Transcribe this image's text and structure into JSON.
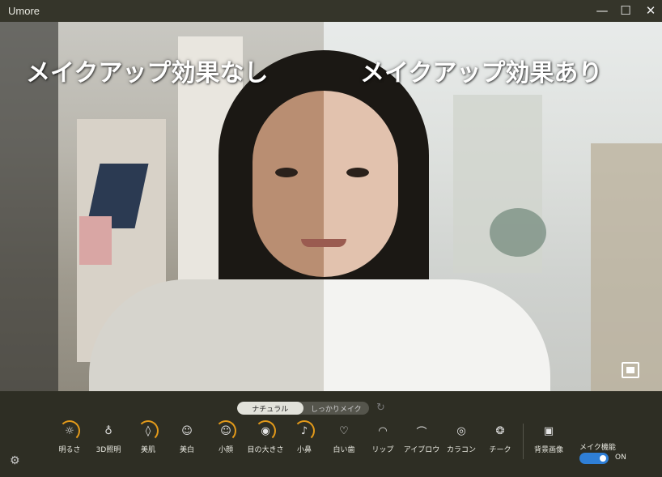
{
  "window": {
    "title": "Umore",
    "minimize_glyph": "—",
    "maximize_glyph": "☐",
    "close_glyph": "✕"
  },
  "preview": {
    "label_without": "メイクアップ効果なし",
    "label_with": "メイクアップ効果あり",
    "pip_icon": "picture-in-picture-icon"
  },
  "modes": {
    "options": [
      "ナチュラル",
      "しっかりメイク"
    ],
    "selected": "ナチュラル",
    "reset_icon": "refresh-icon"
  },
  "tools": [
    {
      "label": "明るさ",
      "icon": "brightness-icon",
      "active": true
    },
    {
      "label": "3D照明",
      "icon": "bulb-icon",
      "active": false
    },
    {
      "label": "美肌",
      "icon": "drop-icon",
      "active": true
    },
    {
      "label": "美白",
      "icon": "face-white-icon",
      "active": false
    },
    {
      "label": "小顔",
      "icon": "face-slim-icon",
      "active": true
    },
    {
      "label": "目の大きさ",
      "icon": "eye-icon",
      "active": true
    },
    {
      "label": "小鼻",
      "icon": "nose-icon",
      "active": true
    },
    {
      "label": "白い歯",
      "icon": "tooth-icon",
      "active": false
    },
    {
      "label": "リップ",
      "icon": "lips-icon",
      "active": false
    },
    {
      "label": "アイブロウ",
      "icon": "eyebrow-icon",
      "active": false
    },
    {
      "label": "カラコン",
      "icon": "contact-lens-icon",
      "active": false
    },
    {
      "label": "チーク",
      "icon": "blush-icon",
      "active": false
    }
  ],
  "background_tool": {
    "label": "背景画像",
    "icon": "image-icon"
  },
  "makeup_function": {
    "label": "メイク機能",
    "state": "ON"
  },
  "settings_icon": "gear-icon",
  "colors": {
    "accent": "#e39a1a",
    "toggle_on": "#2f7fd6"
  }
}
